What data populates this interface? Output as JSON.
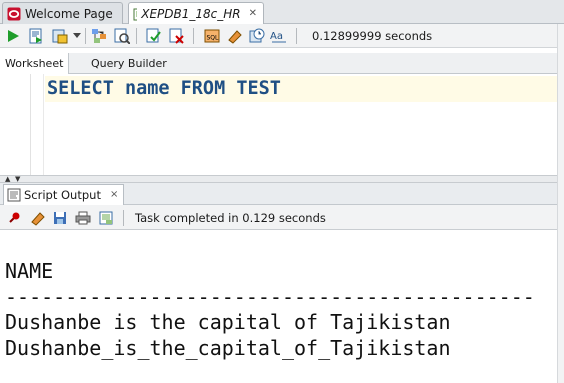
{
  "doc_tabs": [
    {
      "label": "Welcome Page",
      "icon": "oracle-logo-icon",
      "active": false
    },
    {
      "label": "XEPDB1_18c_HR",
      "icon": "sql-worksheet-icon",
      "active": true
    }
  ],
  "toolbar": {
    "run_statement": "run-statement-icon",
    "run_script": "run-script-icon",
    "autotrace": "autotrace-icon",
    "explain_plan": "explain-plan-icon",
    "sql_tuning": "sql-tuning-icon",
    "commit": "commit-icon",
    "rollback": "rollback-icon",
    "unshared": "unshared-sql-worksheet-icon",
    "clear": "clear-eraser-icon",
    "history": "sql-history-icon",
    "format": "format-sql-icon",
    "elapsed": "0.12899999 seconds"
  },
  "sub_tabs": [
    {
      "label": "Worksheet",
      "active": true
    },
    {
      "label": "Query Builder",
      "active": false
    }
  ],
  "editor": {
    "sql": "SELECT name FROM TEST"
  },
  "output_panel": {
    "tab_label": "Script Output",
    "close_label": "×",
    "status": "Task completed in 0.129 seconds",
    "lines": [
      "NAME",
      "--------------------------------------------",
      "Dushanbe is the capital of Tajikistan",
      "Dushanbe_is_the_capital_of_Tajikistan"
    ]
  },
  "colors": {
    "sql_keyword": "#1f4f84",
    "current_line": "#fffbe6",
    "run_green": "#1f9d2b"
  }
}
